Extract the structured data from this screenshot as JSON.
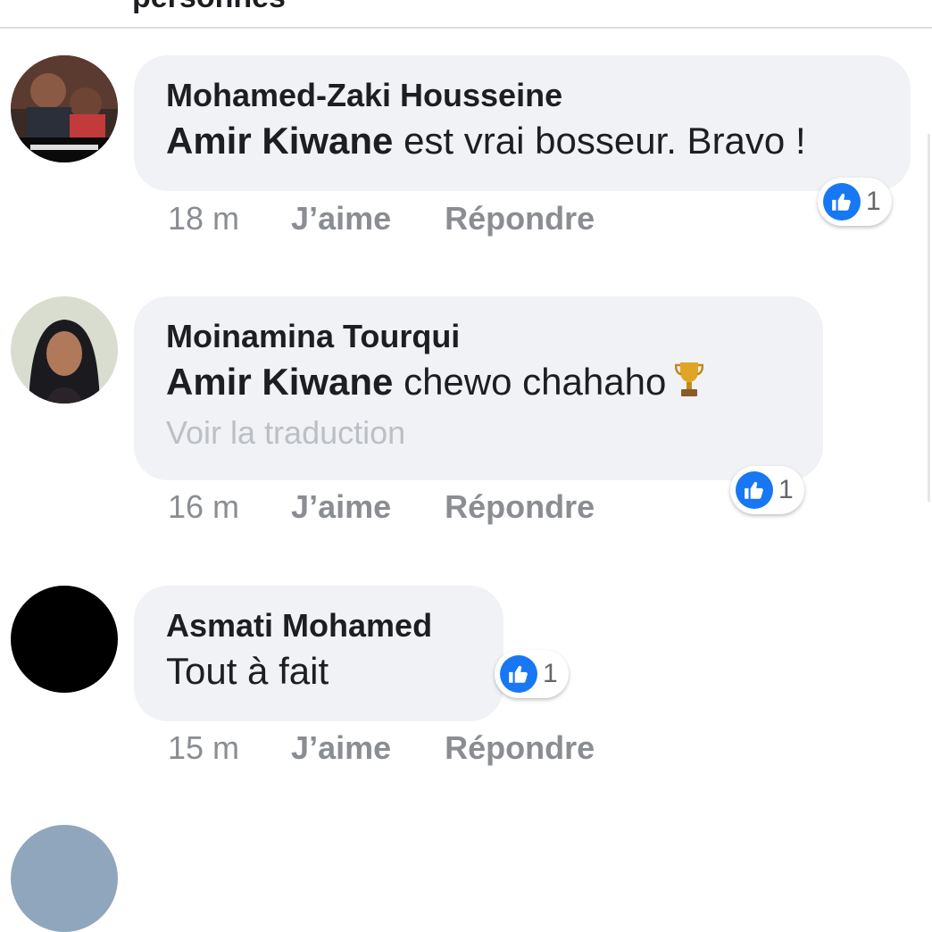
{
  "page": {
    "header_title": "personnes"
  },
  "comments": [
    {
      "author": "Mohamed-Zaki Housseine",
      "mention": "Amir Kiwane",
      "text": " est vrai bosseur. Bravo !",
      "reaction_count": "1",
      "time": "18 m",
      "like_label": "J’aime",
      "reply_label": "Répondre"
    },
    {
      "author": "Moinamina Tourqui",
      "mention": "Amir Kiwane",
      "text": " chewo chahaho",
      "emoji": "trophy-emoji",
      "translation_label": "Voir la traduction",
      "reaction_count": "1",
      "time": "16 m",
      "like_label": "J’aime",
      "reply_label": "Répondre"
    },
    {
      "author": "Asmati Mohamed",
      "text": "Tout à fait",
      "reaction_count": "1",
      "time": "15 m",
      "like_label": "J’aime",
      "reply_label": "Répondre"
    }
  ],
  "colors": {
    "bubble": "#f0f2f5",
    "like_blue": "#1877f2",
    "meta_gray": "#8a8d91",
    "translation_gray": "#bcc0c4"
  },
  "icons": {
    "reaction": "like-thumb-icon"
  }
}
